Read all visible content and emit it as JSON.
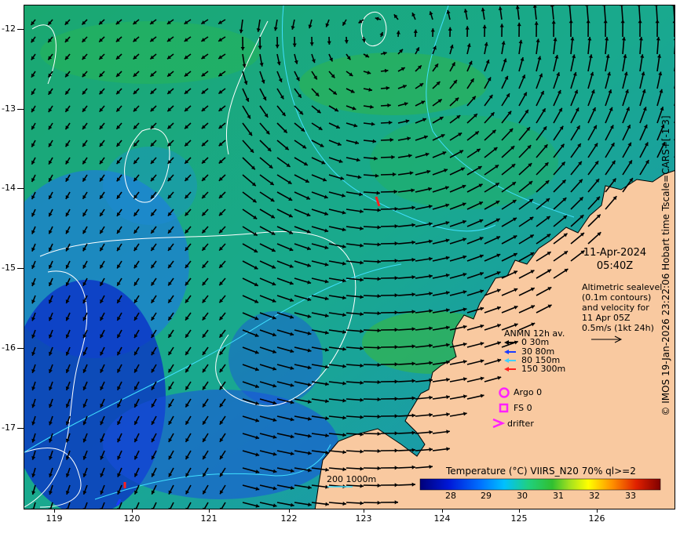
{
  "map": {
    "y_ticks": [
      "-12",
      "-13",
      "-14",
      "-15",
      "-16",
      "-17"
    ],
    "x_ticks": [
      "119",
      "120",
      "121",
      "122",
      "123",
      "124",
      "125",
      "126"
    ]
  },
  "annotation": {
    "date": "11-Apr-2024",
    "time": "05:40Z",
    "desc_lines": [
      "Altimetric sealevel",
      "(0.1m contours)",
      "and velocity for",
      "11 Apr 05Z",
      "0.5m/s (1kt 24h)"
    ]
  },
  "legend": {
    "title": "ANMN 12h av.",
    "depths": [
      {
        "label": "0 30m",
        "color": "#000000"
      },
      {
        "label": "30 80m",
        "color": "#1a3cff"
      },
      {
        "label": "80 150m",
        "color": "#40d0ff"
      },
      {
        "label": "150 300m",
        "color": "#ff2020"
      }
    ],
    "argo": "Argo 0",
    "fs": "FS 0",
    "drifter": "drifter"
  },
  "isobath_label": "200  1000m",
  "colorbar": {
    "title": "Temperature (°C) VIIRS_N20 70% ql>=2",
    "ticks": [
      "28",
      "29",
      "30",
      "31",
      "32",
      "33"
    ]
  },
  "copyright": "© IMOS 19-Jan-2026 23:22:06 Hobart time Tscale=CARS+[-1 3]",
  "colors": {
    "land": "#f9c9a0",
    "ocean_green": "#22b65a",
    "ocean_blue": "#1a5fe0",
    "deep_blue": "#0a2cc8",
    "contour": "#ffffff",
    "isobath": "#40e0ff",
    "magenta": "#ff20ff"
  }
}
